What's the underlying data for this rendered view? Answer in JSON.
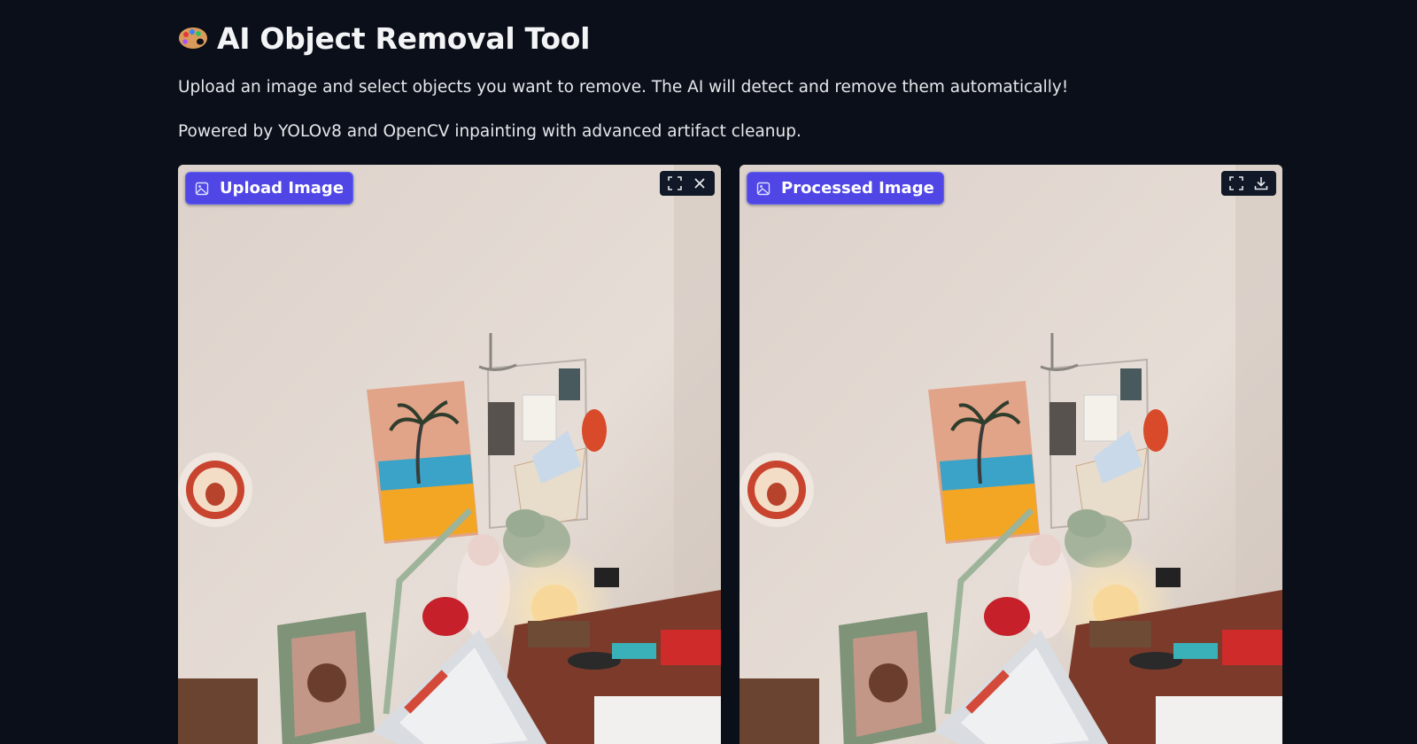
{
  "header": {
    "emoji_icon": "artist-palette",
    "title": "AI Object Removal Tool",
    "description_line1": "Upload an image and select objects you want to remove. The AI will detect and remove them automatically!",
    "description_line2": "Powered by YOLOv8 and OpenCV inpainting with advanced artifact cleanup."
  },
  "input_panel": {
    "label": "Upload Image",
    "label_icon": "image-icon",
    "toolbar": [
      "fullscreen-icon",
      "close-icon"
    ]
  },
  "output_panel": {
    "label": "Processed Image",
    "label_icon": "image-icon",
    "toolbar": [
      "fullscreen-icon",
      "download-icon"
    ]
  },
  "colors": {
    "background": "#0b0f19",
    "accent": "#4f46e5",
    "toolbar_bg": "#111827"
  }
}
